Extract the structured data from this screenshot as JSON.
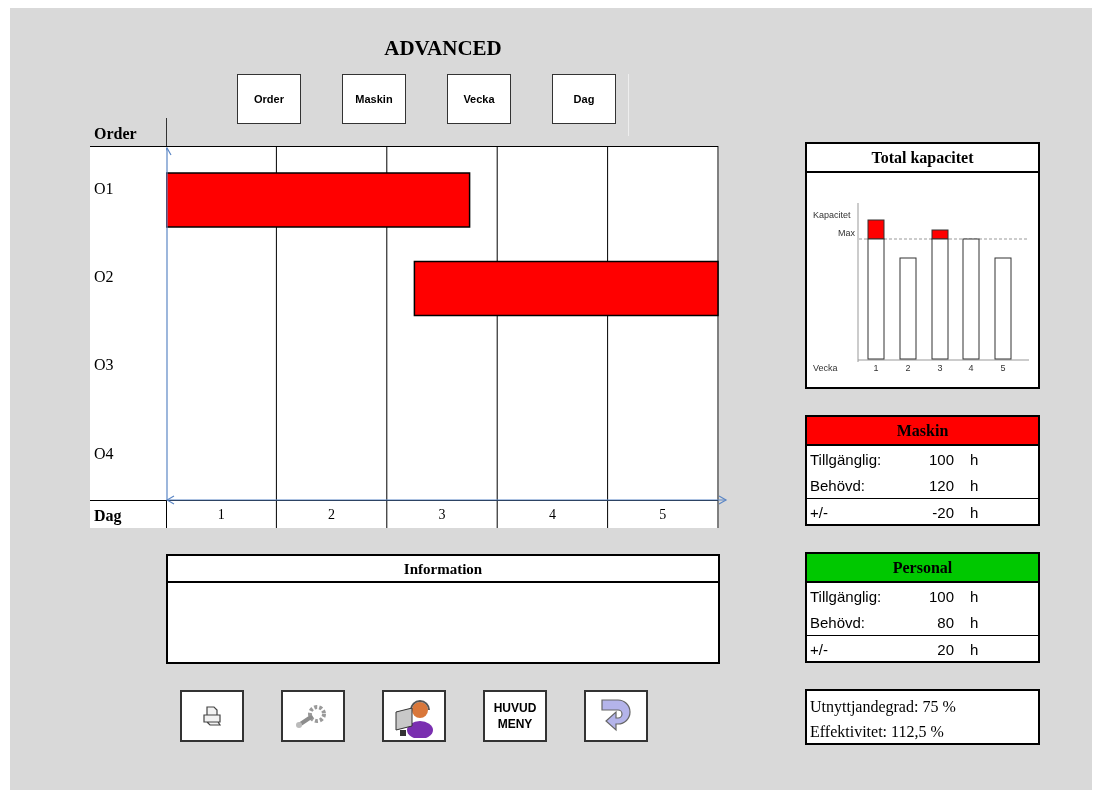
{
  "title": "ADVANCED",
  "view_buttons": [
    "Order",
    "Maskin",
    "Vecka",
    "Dag"
  ],
  "gantt": {
    "row_heading": "Order",
    "column_heading": "Dag",
    "rows": [
      "O1",
      "O2",
      "O3",
      "O4"
    ],
    "days": [
      "1",
      "2",
      "3",
      "4",
      "5"
    ]
  },
  "information": {
    "title": "Information"
  },
  "action_buttons": [
    {
      "kind": "print"
    },
    {
      "kind": "tools"
    },
    {
      "kind": "support"
    },
    {
      "kind": "text",
      "label": "HUVUD MENY"
    },
    {
      "kind": "back"
    }
  ],
  "capacity": {
    "title": "Total kapacitet",
    "y_label": "Kapacitet",
    "max_label": "Max",
    "x_label": "Vecka",
    "categories": [
      "1",
      "2",
      "3",
      "4",
      "5"
    ]
  },
  "panels": [
    {
      "title": "Maskin",
      "color": "#ff0000",
      "rows": [
        {
          "label": "Tillgänglig:",
          "value": "100",
          "unit": "h",
          "kind": "item"
        },
        {
          "label": "Behövd:",
          "value": "120",
          "unit": "h",
          "kind": "item"
        },
        {
          "label": "+/-",
          "value": "-20",
          "unit": "h",
          "kind": "total"
        }
      ]
    },
    {
      "title": "Personal",
      "color": "#00c800",
      "rows": [
        {
          "label": "Tillgänglig:",
          "value": "100",
          "unit": "h",
          "kind": "item"
        },
        {
          "label": "Behövd:",
          "value": "80",
          "unit": "h",
          "kind": "item"
        },
        {
          "label": "+/-",
          "value": "20",
          "unit": "h",
          "kind": "total"
        }
      ]
    }
  ],
  "summary": [
    "Utnyttjandegrad: 75 %",
    "Effektivitet: 112,5 %"
  ]
}
